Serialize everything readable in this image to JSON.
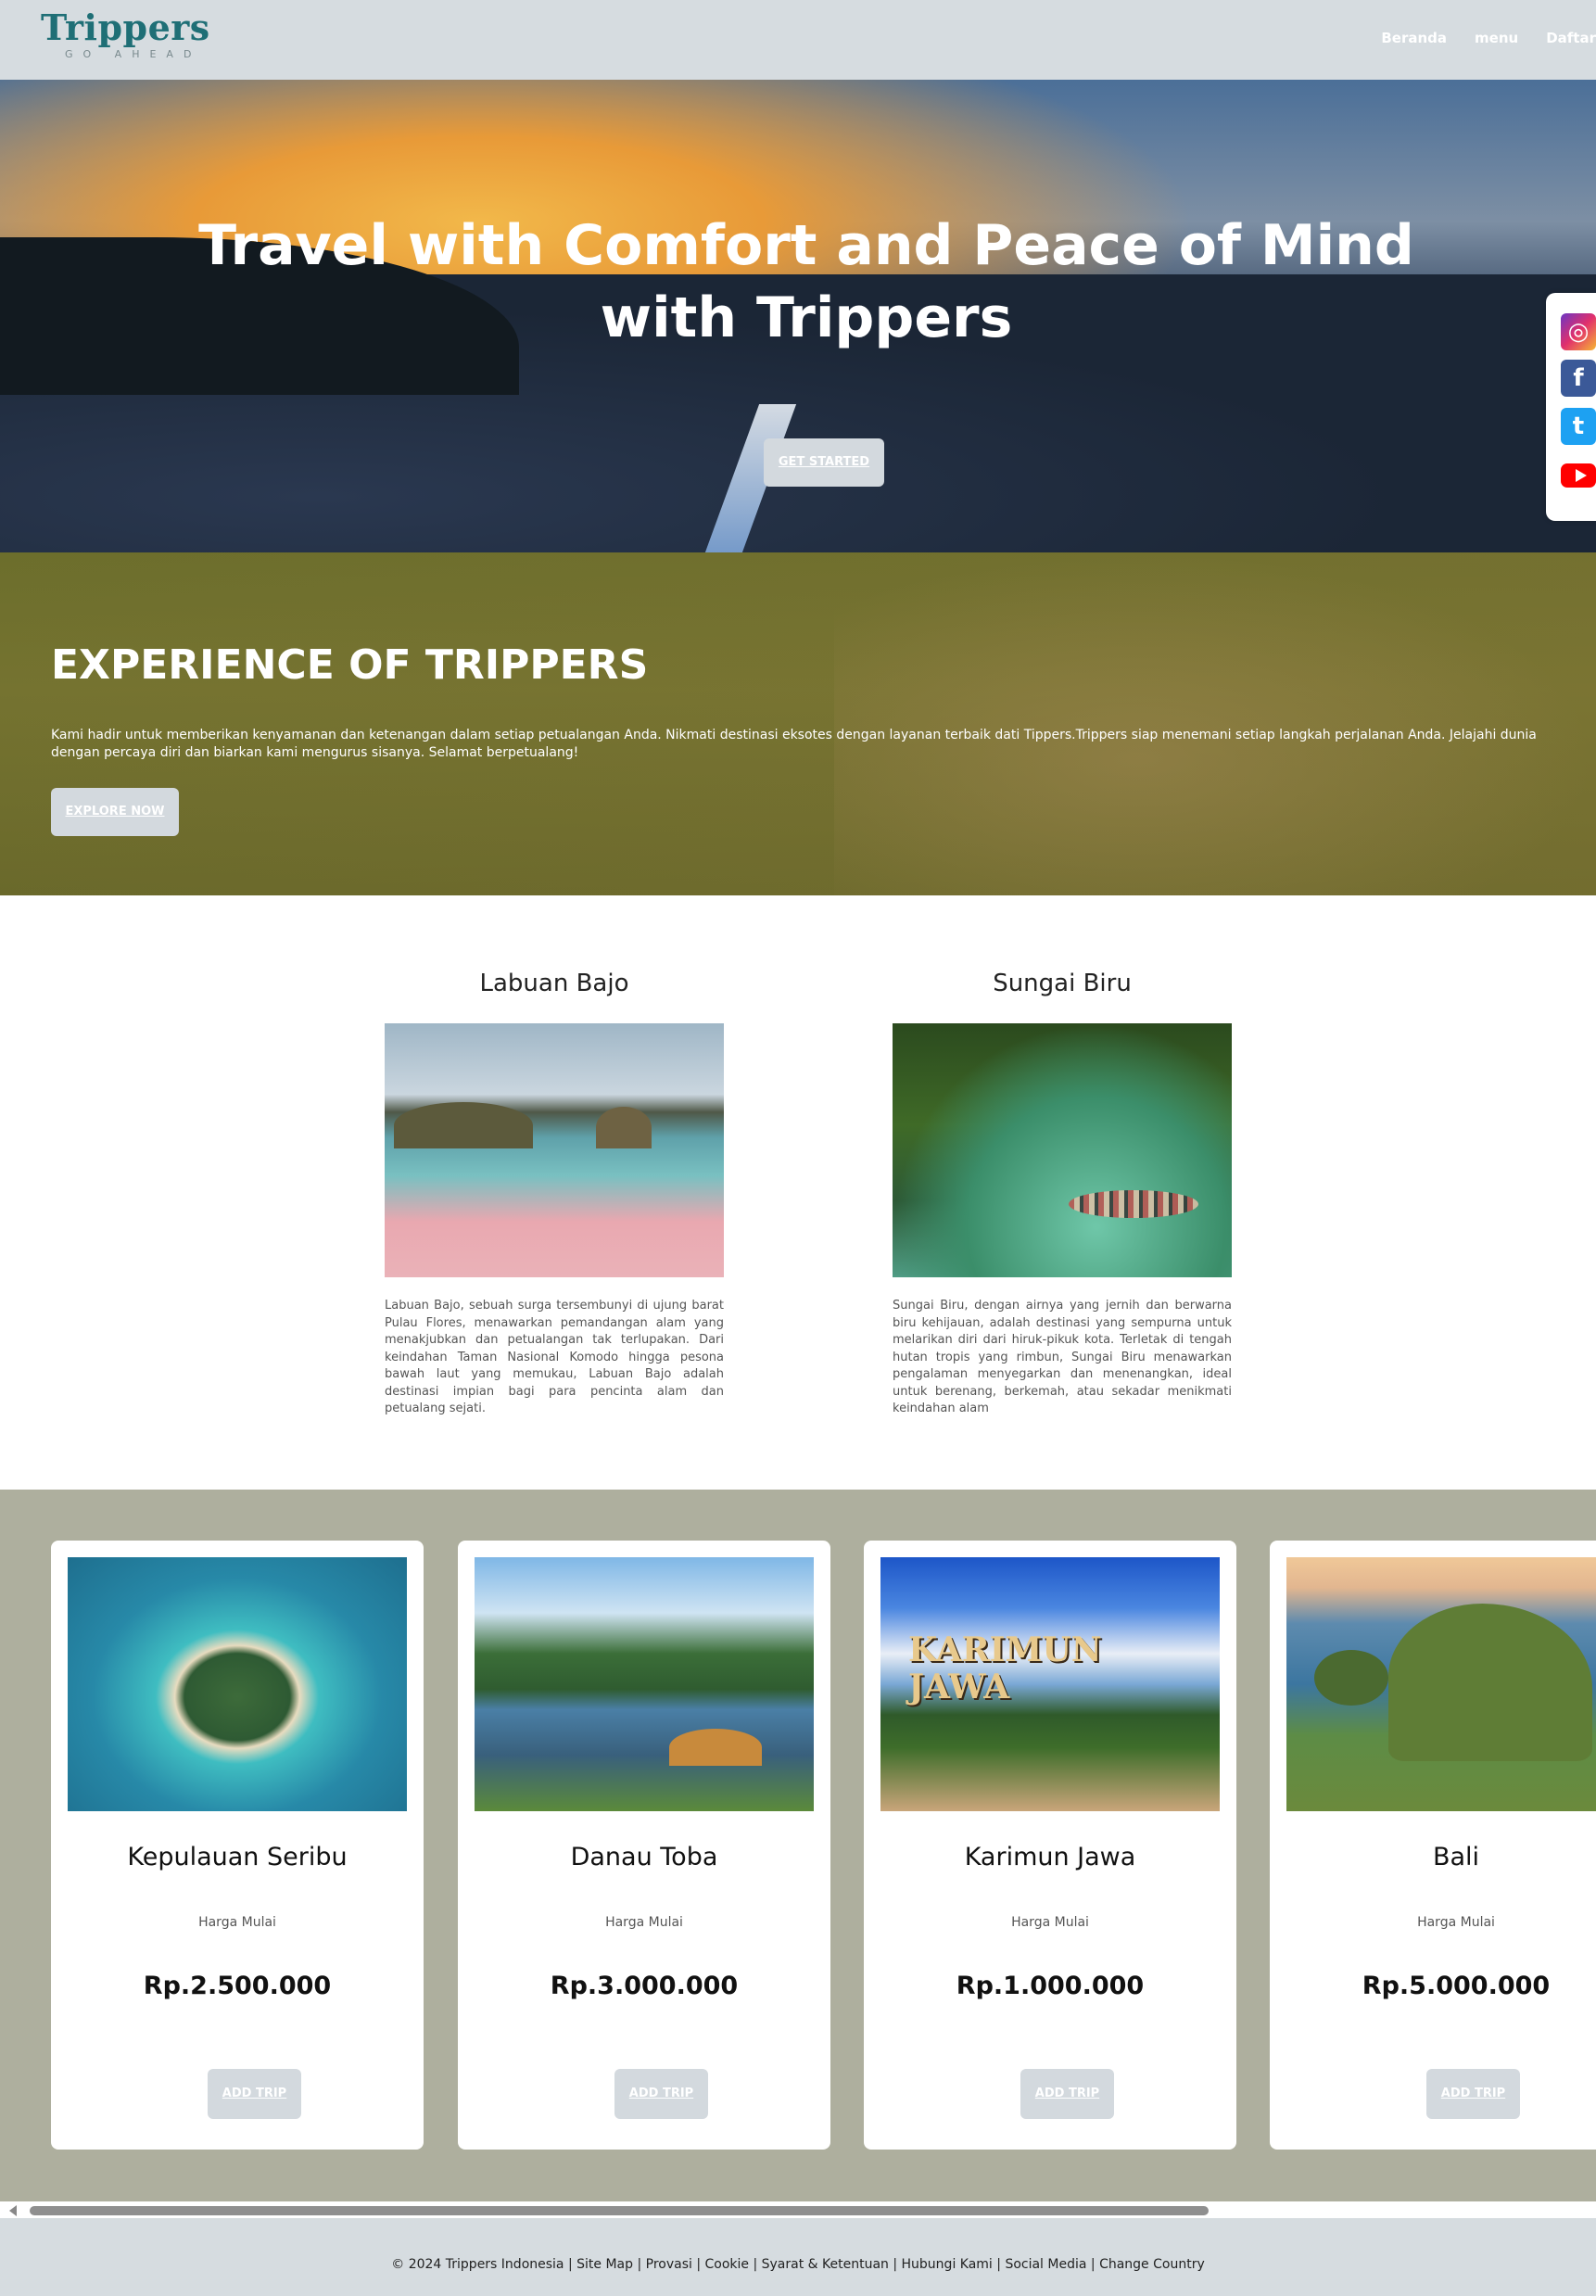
{
  "header": {
    "logo_title": "Trippers",
    "logo_subtitle": "GO AHEAD",
    "nav": [
      "Beranda",
      "menu",
      "Daftar"
    ]
  },
  "hero": {
    "title": "Travel with Comfort and Peace of Mind with Trippers",
    "button": "GET STARTED"
  },
  "social": [
    "instagram-icon",
    "facebook-icon",
    "twitter-icon",
    "youtube-icon"
  ],
  "experience": {
    "title": "EXPERIENCE OF TRIPPERS",
    "text": "Kami hadir untuk memberikan kenyamanan dan ketenangan dalam setiap petualangan Anda. Nikmati destinasi eksotes dengan layanan terbaik dati Tippers.Trippers siap menemani setiap langkah perjalanan Anda. Jelajahi dunia dengan percaya diri dan biarkan kami mengurus sisanya. Selamat berpetualang!",
    "button": "EXPLORE NOW"
  },
  "destinations": [
    {
      "title": "Labuan Bajo",
      "text": "Labuan Bajo, sebuah surga tersembunyi di ujung barat Pulau Flores, menawarkan pemandangan alam yang menakjubkan dan petualangan tak terlupakan. Dari keindahan Taman Nasional Komodo hingga pesona bawah laut yang memukau, Labuan Bajo adalah destinasi impian bagi para pencinta alam dan petualang sejati."
    },
    {
      "title": "Sungai Biru",
      "text": "Sungai Biru, dengan airnya yang jernih dan berwarna biru kehijauan, adalah destinasi yang sempurna untuk melarikan diri dari hiruk-pikuk kota. Terletak di tengah hutan tropis yang rimbun, Sungai Biru menawarkan pengalaman menyegarkan dan menenangkan, ideal untuk berenang, berkemah, atau sekadar menikmati keindahan alam"
    }
  ],
  "trips": [
    {
      "title": "Kepulauan Seribu",
      "sub": "Harga Mulai",
      "price": "Rp.2.500.000",
      "button": "ADD TRIP"
    },
    {
      "title": "Danau Toba",
      "sub": "Harga Mulai",
      "price": "Rp.3.000.000",
      "button": "ADD TRIP"
    },
    {
      "title": "Karimun Jawa",
      "sub": "Harga Mulai",
      "price": "Rp.1.000.000",
      "button": "ADD TRIP",
      "sign": "KARIMUN JAWA"
    },
    {
      "title": "Bali",
      "sub": "Harga Mulai",
      "price": "Rp.5.000.000",
      "button": "ADD TRIP"
    }
  ],
  "footer": {
    "text": "© 2024 Trippers Indonesia | Site Map | Provasi | Cookie | Syarat & Ketentuan | Hubungi Kami | Social Media | Change Country"
  },
  "colors": {
    "header_bg": "#d6dce0",
    "logo": "#1f6f76",
    "experience_bg": "#6c6e2c",
    "trips_bg": "#aeaf9e",
    "button_bg": "#d3d9de"
  }
}
